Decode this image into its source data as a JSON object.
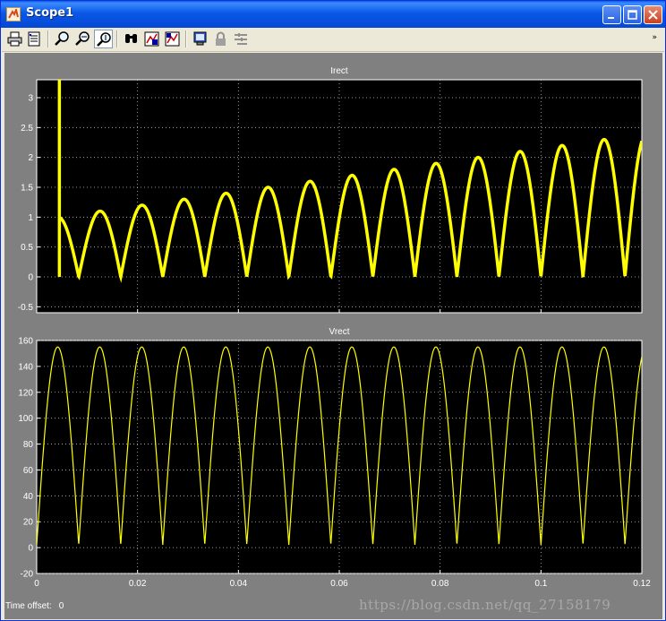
{
  "window": {
    "title": "Scope1",
    "app_icon": "matlab-icon",
    "controls": [
      "minimize-icon",
      "maximize-icon",
      "close-icon"
    ]
  },
  "toolbar": {
    "tools": [
      {
        "name": "print",
        "icon": "printer-icon"
      },
      {
        "name": "parameters",
        "icon": "parameters-icon"
      },
      {
        "name": "zoom",
        "icon": "zoom-icon"
      },
      {
        "name": "zoom-x",
        "icon": "zoom-x-icon"
      },
      {
        "name": "zoom-y",
        "icon": "zoom-y-icon",
        "pressed": true
      },
      {
        "name": "autoscale",
        "icon": "binoculars-icon"
      },
      {
        "name": "save-axes",
        "icon": "save-axes-icon"
      },
      {
        "name": "restore-axes",
        "icon": "restore-axes-icon"
      },
      {
        "name": "floating-scope",
        "icon": "floating-scope-icon"
      },
      {
        "name": "lock-axes",
        "icon": "lock-icon"
      },
      {
        "name": "signal-selection",
        "icon": "signal-selection-icon"
      }
    ]
  },
  "colors": {
    "trace": "#ffff00",
    "axes_bg": "#000000",
    "figure_bg": "#808080",
    "text": "#ffffff",
    "grid": "#bfbfbf"
  },
  "chart_data": [
    {
      "type": "line",
      "title": "Irect",
      "xlim": [
        0,
        0.12
      ],
      "ylim": [
        -0.6,
        3.3
      ],
      "yticks": [
        -0.5,
        0,
        0.5,
        1,
        1.5,
        2,
        2.5,
        3
      ],
      "ytick_labels": [
        "-0.5",
        "0",
        "0.5",
        "1",
        "1.5",
        "2",
        "2.5",
        "3"
      ],
      "xticks": [
        0,
        0.02,
        0.04,
        0.06,
        0.08,
        0.1,
        0.12
      ],
      "grid": true,
      "description_of_series": "full-wave rectified current, envelope rising linearly",
      "series": [
        {
          "name": "",
          "start_time": 0.0045,
          "initial_spike": 3.3,
          "peaks": [
            {
              "x": 0.0125,
              "y": 1.1
            },
            {
              "x": 0.0208,
              "y": 1.22
            },
            {
              "x": 0.0292,
              "y": 1.33
            },
            {
              "x": 0.0375,
              "y": 1.45
            },
            {
              "x": 0.0458,
              "y": 1.55
            },
            {
              "x": 0.0542,
              "y": 1.66
            },
            {
              "x": 0.0625,
              "y": 1.77
            },
            {
              "x": 0.0708,
              "y": 1.87
            },
            {
              "x": 0.0792,
              "y": 1.95
            },
            {
              "x": 0.0875,
              "y": 2.05
            },
            {
              "x": 0.0958,
              "y": 2.13
            },
            {
              "x": 0.1042,
              "y": 2.22
            },
            {
              "x": 0.1125,
              "y": 2.3
            }
          ],
          "period": 0.008333,
          "zeros_at": [
            0.0083,
            0.0167,
            0.025,
            0.0333,
            0.0417,
            0.05,
            0.0583,
            0.0667,
            0.075,
            0.0833,
            0.0917,
            0.1,
            0.1083,
            0.1167
          ]
        }
      ]
    },
    {
      "type": "line",
      "title": "Vrect",
      "xlim": [
        0,
        0.12
      ],
      "ylim": [
        -20,
        160
      ],
      "yticks": [
        -20,
        0,
        20,
        40,
        60,
        80,
        100,
        120,
        140,
        160
      ],
      "ytick_labels": [
        "-20",
        "0",
        "20",
        "40",
        "60",
        "80",
        "100",
        "120",
        "140",
        "160"
      ],
      "xticks": [
        0,
        0.02,
        0.04,
        0.06,
        0.08,
        0.1,
        0.12
      ],
      "xtick_labels": [
        "0",
        "0.02",
        "0.04",
        "0.06",
        "0.08",
        "0.1",
        "0.12"
      ],
      "grid": true,
      "series": [
        {
          "name": "",
          "amplitude": 155,
          "period": 0.008333,
          "min": 2,
          "peaks_at": [
            0.0042,
            0.0125,
            0.0208,
            0.0292,
            0.0375,
            0.0458,
            0.0542,
            0.0625,
            0.0708,
            0.0792,
            0.0875,
            0.0958,
            0.1042,
            0.1125
          ]
        }
      ]
    }
  ],
  "status": {
    "time_offset_label": "Time offset:",
    "time_offset_value": "0"
  },
  "watermark": "https://blog.csdn.net/qq_27158179"
}
